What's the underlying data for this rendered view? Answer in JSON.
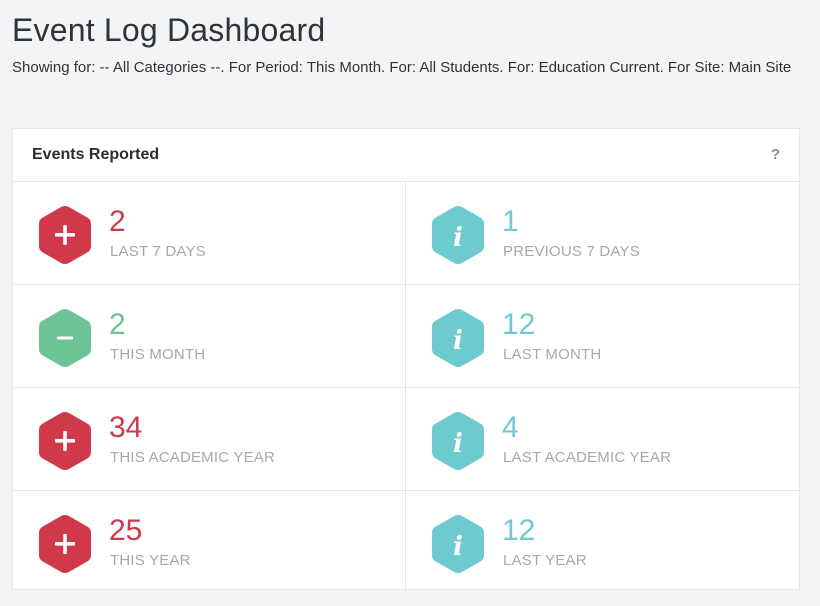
{
  "header": {
    "title": "Event Log Dashboard",
    "subtitle": "Showing for: -- All Categories --. For Period: This Month. For: All Students. For: Education Current. For Site: Main Site"
  },
  "panel": {
    "title": "Events Reported",
    "help": "?"
  },
  "colors": {
    "red": "#d0394a",
    "green": "#6cc497",
    "teal": "#6dcbcf"
  },
  "stats": [
    {
      "value": "2",
      "label": "LAST 7 DAYS",
      "color": "red",
      "icon": "plus-icon"
    },
    {
      "value": "1",
      "label": "PREVIOUS 7 DAYS",
      "color": "teal",
      "icon": "info-icon"
    },
    {
      "value": "2",
      "label": "THIS MONTH",
      "color": "green",
      "icon": "minus-icon"
    },
    {
      "value": "12",
      "label": "LAST MONTH",
      "color": "teal",
      "icon": "info-icon"
    },
    {
      "value": "34",
      "label": "THIS ACADEMIC YEAR",
      "color": "red",
      "icon": "plus-icon"
    },
    {
      "value": "4",
      "label": "LAST ACADEMIC YEAR",
      "color": "teal",
      "icon": "info-icon"
    },
    {
      "value": "25",
      "label": "THIS YEAR",
      "color": "red",
      "icon": "plus-icon"
    },
    {
      "value": "12",
      "label": "LAST YEAR",
      "color": "teal",
      "icon": "info-icon"
    }
  ]
}
